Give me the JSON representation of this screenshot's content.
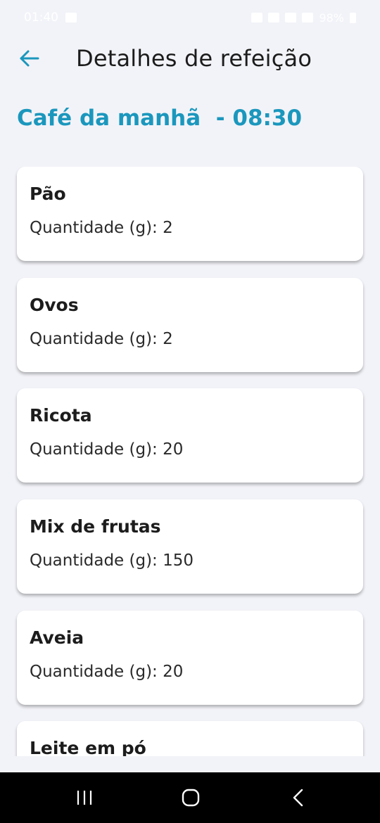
{
  "status_bar": {
    "time": "01:40",
    "battery": "98%"
  },
  "app_bar": {
    "title": "Detalhes de refeição",
    "back_icon": "arrow-left-icon"
  },
  "meal": {
    "heading": "Café da manhã  - 08:30"
  },
  "items": [
    {
      "name": "Pão",
      "quantity": "Quantidade (g): 2"
    },
    {
      "name": "Ovos",
      "quantity": "Quantidade (g): 2"
    },
    {
      "name": "Ricota",
      "quantity": "Quantidade (g): 20"
    },
    {
      "name": "Mix de frutas",
      "quantity": "Quantidade (g): 150"
    },
    {
      "name": "Aveia",
      "quantity": "Quantidade (g): 20"
    },
    {
      "name": "Leite em pó",
      "quantity": ""
    }
  ],
  "nav_bar": {
    "recents_icon": "recents-icon",
    "home_icon": "home-icon",
    "back_icon": "back-chevron-icon"
  },
  "colors": {
    "accent": "#1b97bd",
    "background": "#f2f3f8",
    "card": "#ffffff"
  }
}
